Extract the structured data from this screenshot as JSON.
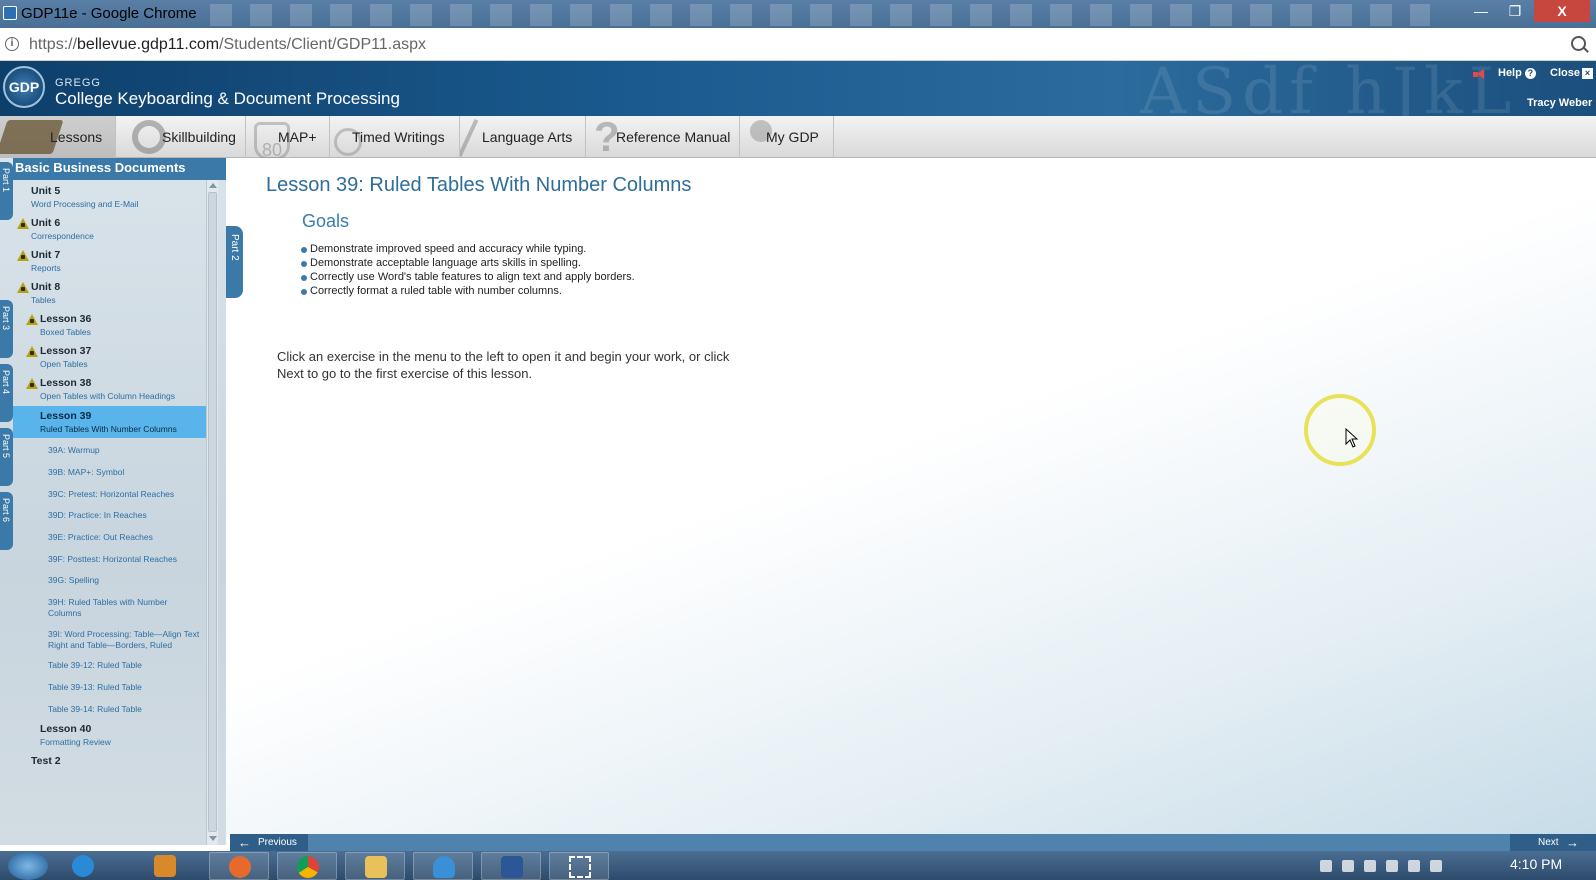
{
  "window": {
    "title": "GDP11e - Google Chrome",
    "controls": {
      "minimize": "—",
      "maximize": "❐",
      "close": "X"
    }
  },
  "address": {
    "url_prefix": "https://",
    "url_host": "bellevue.gdp11.com",
    "url_path": "/Students/Client/GDP11.aspx"
  },
  "header": {
    "logo": "GDP",
    "brand_small": "GREGG",
    "brand_main": "College Keyboarding & Document Processing",
    "bg_letters": "ASdf hJkL",
    "help": "Help",
    "close": "Close",
    "user": "Tracy Weber"
  },
  "nav": {
    "tabs": [
      {
        "label": "Lessons",
        "icon": "book-icon"
      },
      {
        "label": "Skillbuilding",
        "icon": "target-icon"
      },
      {
        "label": "MAP+",
        "icon": "road-sign-icon"
      },
      {
        "label": "Timed Writings",
        "icon": "stopwatch-icon"
      },
      {
        "label": "Language Arts",
        "icon": "pen-icon"
      },
      {
        "label": "Reference Manual",
        "icon": "question-icon"
      },
      {
        "label": "My GDP",
        "icon": "person-icon"
      }
    ],
    "active": "Lessons"
  },
  "sidebar": {
    "header": "Basic Business Documents",
    "part_tabs": [
      "Part 1",
      "Part 3",
      "Part 4",
      "Part 5",
      "Part 6"
    ],
    "items": [
      {
        "title": "Unit 5",
        "subtitle": "Word Processing and E-Mail",
        "locked": false
      },
      {
        "title": "Unit 6",
        "subtitle": "Correspondence",
        "locked": true
      },
      {
        "title": "Unit 7",
        "subtitle": "Reports",
        "locked": true
      },
      {
        "title": "Unit 8",
        "subtitle": "Tables",
        "locked": true
      },
      {
        "title": "Lesson 36",
        "subtitle": "Boxed Tables",
        "locked": true
      },
      {
        "title": "Lesson 37",
        "subtitle": "Open Tables",
        "locked": true
      },
      {
        "title": "Lesson 38",
        "subtitle": "Open Tables with Column Headings",
        "locked": true
      },
      {
        "title": "Lesson 39",
        "subtitle": "Ruled Tables With Number Columns",
        "locked": false,
        "selected": true
      }
    ],
    "exercises": [
      "39A: Warmup",
      "39B: MAP+: Symbol",
      "39C: Pretest: Horizontal Reaches",
      "39D: Practice: In Reaches",
      "39E: Practice: Out Reaches",
      "39F: Posttest: Horizontal Reaches",
      "39G: Spelling",
      "39H: Ruled Tables with Number Columns",
      "39I: Word Processing: Table—Align Text Right and Table—Borders, Ruled",
      "Table 39-12: Ruled Table",
      "Table 39-13: Ruled Table",
      "Table 39-14: Ruled Table"
    ],
    "after": [
      {
        "title": "Lesson 40",
        "subtitle": "Formatting Review"
      },
      {
        "title": "Test 2",
        "subtitle": ""
      }
    ]
  },
  "main": {
    "part_tab": "Part 2",
    "lesson_title": "Lesson 39: Ruled Tables With Number Columns",
    "goals_title": "Goals",
    "goals": [
      "Demonstrate improved speed and accuracy while typing.",
      "Demonstrate acceptable language arts skills in spelling.",
      "Correctly use Word's table features to align text and apply borders.",
      "Correctly format a ruled table with number columns."
    ],
    "instructions": "Click an exercise in the menu to the left to open it and begin your work, or click Next to go to the first exercise of this lesson."
  },
  "footer": {
    "previous": "Previous",
    "next": "Next"
  },
  "taskbar": {
    "apps": [
      "firefox-icon",
      "chrome-icon",
      "folder-icon",
      "onedrive-icon",
      "word-icon",
      "snipping-tool-icon"
    ],
    "time": "4:10 PM"
  },
  "colors": {
    "header_blue": "#1a5a8e",
    "sidebar_blue": "#3b79a8",
    "selected_item": "#58b4ea",
    "title_blue": "#2f6d9a",
    "lock_gold": "#b9a10e"
  }
}
